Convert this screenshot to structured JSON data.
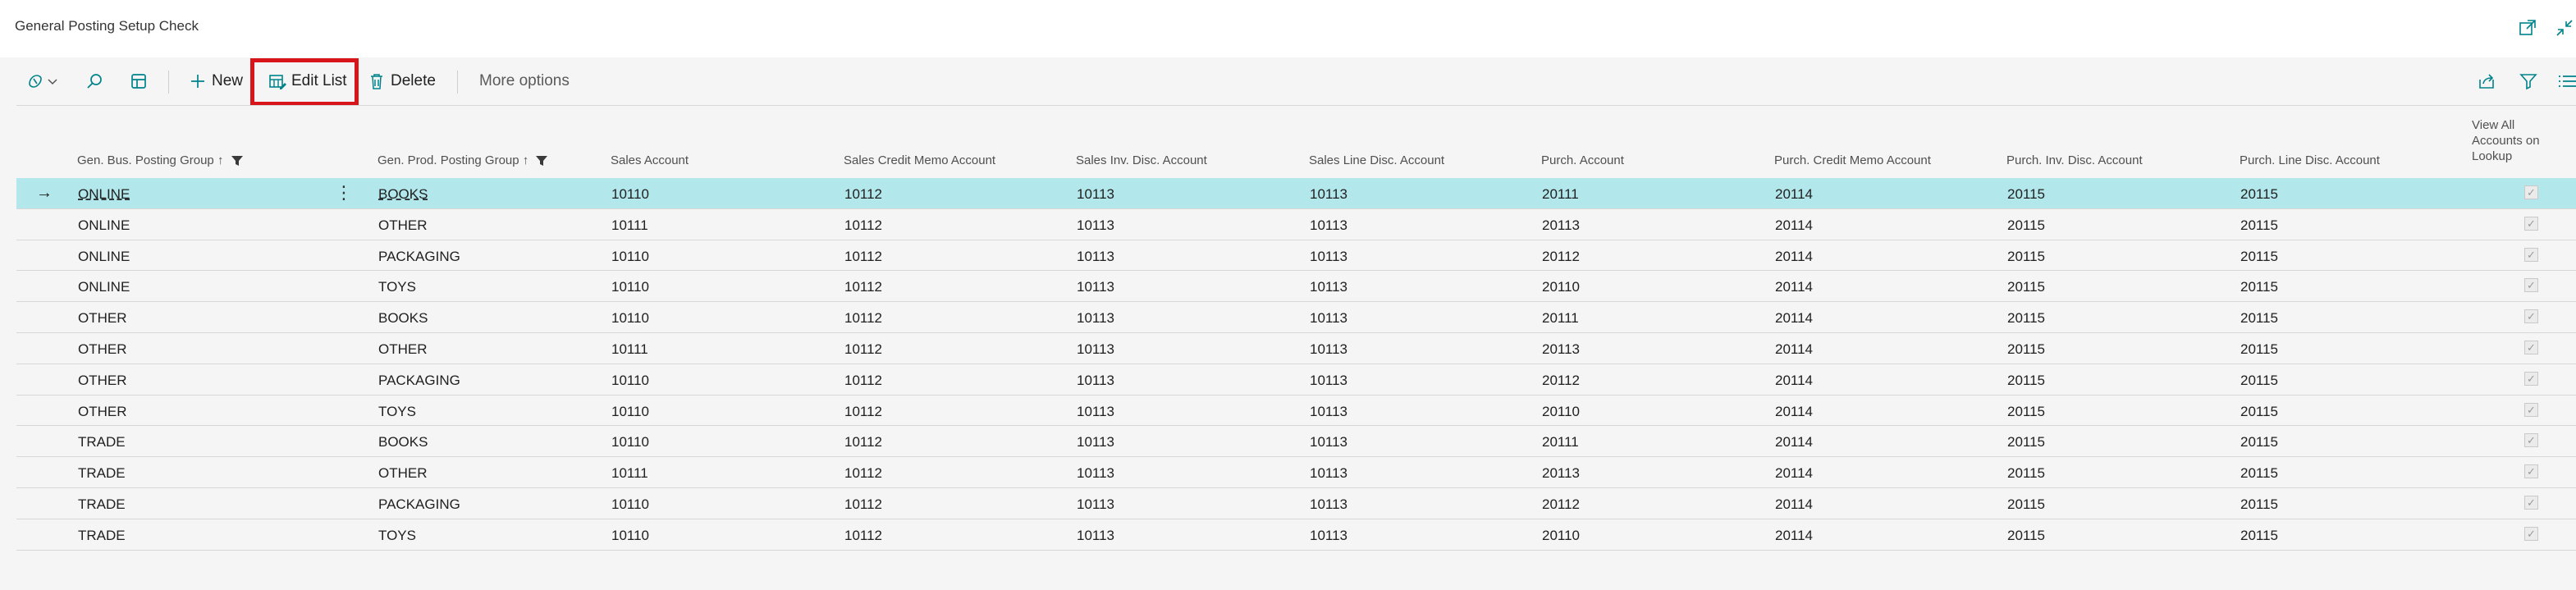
{
  "window": {
    "title": "General Posting Setup Check"
  },
  "toolbar": {
    "new_label": "New",
    "edit_list_label": "Edit List",
    "delete_label": "Delete",
    "more_options_label": "More options"
  },
  "columns": [
    "Gen. Bus. Posting Group",
    "Gen. Prod. Posting Group",
    "Sales Account",
    "Sales Credit Memo Account",
    "Sales Inv. Disc. Account",
    "Sales Line Disc. Account",
    "Purch. Account",
    "Purch. Credit Memo Account",
    "Purch. Inv. Disc. Account",
    "Purch. Line Disc. Account",
    "View All Accounts on Lookup"
  ],
  "view_all_header": [
    "View All",
    "Accounts on",
    "Lookup"
  ],
  "rows": [
    [
      "ONLINE",
      "BOOKS",
      "10110",
      "10112",
      "10113",
      "10113",
      "20111",
      "20114",
      "20115",
      "20115"
    ],
    [
      "ONLINE",
      "OTHER",
      "10111",
      "10112",
      "10113",
      "10113",
      "20113",
      "20114",
      "20115",
      "20115"
    ],
    [
      "ONLINE",
      "PACKAGING",
      "10110",
      "10112",
      "10113",
      "10113",
      "20112",
      "20114",
      "20115",
      "20115"
    ],
    [
      "ONLINE",
      "TOYS",
      "10110",
      "10112",
      "10113",
      "10113",
      "20110",
      "20114",
      "20115",
      "20115"
    ],
    [
      "OTHER",
      "BOOKS",
      "10110",
      "10112",
      "10113",
      "10113",
      "20111",
      "20114",
      "20115",
      "20115"
    ],
    [
      "OTHER",
      "OTHER",
      "10111",
      "10112",
      "10113",
      "10113",
      "20113",
      "20114",
      "20115",
      "20115"
    ],
    [
      "OTHER",
      "PACKAGING",
      "10110",
      "10112",
      "10113",
      "10113",
      "20112",
      "20114",
      "20115",
      "20115"
    ],
    [
      "OTHER",
      "TOYS",
      "10110",
      "10112",
      "10113",
      "10113",
      "20110",
      "20114",
      "20115",
      "20115"
    ],
    [
      "TRADE",
      "BOOKS",
      "10110",
      "10112",
      "10113",
      "10113",
      "20111",
      "20114",
      "20115",
      "20115"
    ],
    [
      "TRADE",
      "OTHER",
      "10111",
      "10112",
      "10113",
      "10113",
      "20113",
      "20114",
      "20115",
      "20115"
    ],
    [
      "TRADE",
      "PACKAGING",
      "10110",
      "10112",
      "10113",
      "10113",
      "20112",
      "20114",
      "20115",
      "20115"
    ],
    [
      "TRADE",
      "TOYS",
      "10110",
      "10112",
      "10113",
      "10113",
      "20110",
      "20114",
      "20115",
      "20115"
    ]
  ],
  "view_all_checked": [
    true,
    true,
    true,
    true,
    true,
    true,
    true,
    true,
    true,
    true,
    true,
    true
  ],
  "selected_row": 0,
  "colors": {
    "accent": "#00838a",
    "selected_row": "#b2e7ec",
    "highlight_box": "#d9151c"
  }
}
